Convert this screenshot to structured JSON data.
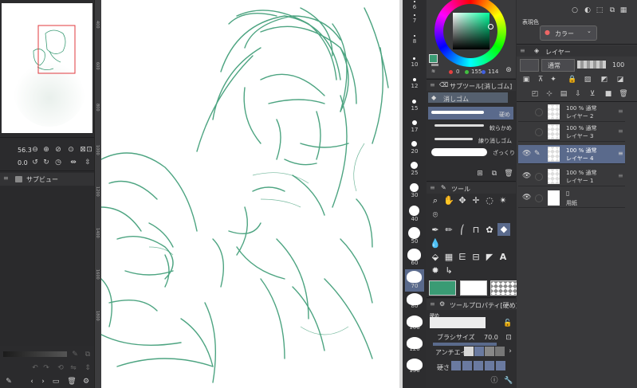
{
  "navigator": {
    "zoom": "56.3",
    "rotation": "0.0"
  },
  "subview": {
    "title": "サブビュー"
  },
  "ruler": {
    "marks": [
      "400",
      "600",
      "800",
      "1000",
      "1200",
      "1400",
      "1600",
      "1800"
    ]
  },
  "brush_sizes": [
    "6",
    "7",
    "8",
    "10",
    "12",
    "15",
    "17",
    "20",
    "25",
    "30",
    "40",
    "50",
    "60",
    "70",
    "80",
    "100",
    "120",
    "150"
  ],
  "brush_size_selected": "70",
  "color_wheel": {
    "r": "0",
    "g": "155",
    "b": "114",
    "current_color": "#3a9b74"
  },
  "sub_tool": {
    "title": "サブツール[消しゴム]",
    "group": "消しゴム",
    "items": [
      "硬め",
      "較らかめ",
      "練り消しゴム",
      "ざっくり"
    ]
  },
  "tool_panel": {
    "title": "ツール"
  },
  "tool_property": {
    "title": "ツールプロパティ[硬め]",
    "name": "硬め",
    "brush_size_label": "ブラシサイズ",
    "brush_size_value": "70.0",
    "antialias_label": "アンチエイ",
    "hardness_label": "硬さ"
  },
  "display_color": {
    "label": "表現色",
    "value": "カラー"
  },
  "layer_panel": {
    "title": "レイヤー",
    "blend_mode": "通常",
    "opacity": "100",
    "layers": [
      {
        "opacity_mode": "100 % 通常",
        "name": "レイヤー 2",
        "selected": false,
        "visible": false
      },
      {
        "opacity_mode": "100 % 通常",
        "name": "レイヤー 3",
        "selected": false,
        "visible": false
      },
      {
        "opacity_mode": "100 % 通常",
        "name": "レイヤー 4",
        "selected": true,
        "visible": true
      },
      {
        "opacity_mode": "100 % 通常",
        "name": "レイヤー 1",
        "selected": false,
        "visible": true
      },
      {
        "opacity_mode": "",
        "name": "用紙",
        "selected": false,
        "visible": true
      }
    ]
  },
  "colors": {
    "accent": "#3a9b74",
    "selected_row": "#5a6a8c",
    "canvas": "#ffffff"
  }
}
